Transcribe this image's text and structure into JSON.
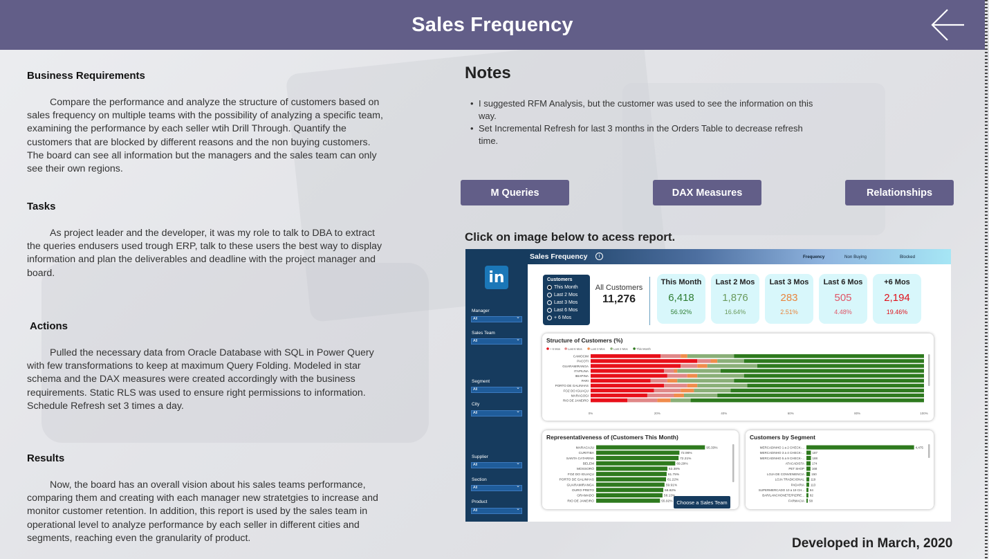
{
  "header": {
    "title": "Sales Frequency"
  },
  "left": {
    "business": {
      "heading": "Business Requirements",
      "text": "Compare the performance and analyze the structure of customers based on sales frequency on multiple teams with the possibility of analyzing a specific team, examining the performance by each seller wtih Drill Through. Quantify the customers that are blocked by different reasons and the non buying customers. The board can see all information but the managers and the sales team can only see their own regions."
    },
    "tasks": {
      "heading": "Tasks",
      "text": "As project leader and the developer, it was my role to talk to DBA to extract the queries endusers used trough ERP, talk to these users the best way to display information and plan the deliverables and deadline with the project manager and board."
    },
    "actions": {
      "heading": "Actions",
      "text": "Pulled the necessary data from Oracle Database with SQL in Power Query with few transformations to keep at maximum Query Folding. Modeled in star schema and the DAX measures were created accordingly with the business requirements. Static RLS was used to ensure right permissions to information. Schedule Refresh set 3 times a day."
    },
    "results": {
      "heading": "Results",
      "text": "Now, the board has an overall vision about his sales teams performance, comparing them and creating with each manager new stratetgies to increase and monitor customer retention. In addition, this report is used by the sales team in operational level to analyze performance by each seller in different cities and segments, reaching even the granularity of product."
    }
  },
  "notes": {
    "title": "Notes",
    "items": [
      "I suggested RFM Analysis, but the customer was used to see the information on this way.",
      "Set Incremental Refresh for last 3 months in the Orders Table to decrease refresh time."
    ]
  },
  "buttons": {
    "m_queries": "M Queries",
    "dax": "DAX Measures",
    "relationships": "Relationships"
  },
  "cta": "Click on image below to acess report.",
  "footer": "Developed in March, 2020",
  "report": {
    "title": "Sales Frequency",
    "info_icon": "i",
    "tabs": [
      "Frequency",
      "Non Buying",
      "Blocked"
    ],
    "logo": "in",
    "filters": [
      {
        "label": "Manager",
        "value": "All"
      },
      {
        "label": "Sales Team",
        "value": "All"
      },
      {
        "label": "Segment",
        "value": "All"
      },
      {
        "label": "City",
        "value": "All"
      },
      {
        "label": "Supplier",
        "value": "All"
      },
      {
        "label": "Section",
        "value": "All"
      },
      {
        "label": "Product",
        "value": "All"
      }
    ],
    "customers_selector": {
      "title": "Customers",
      "options": [
        "This Month",
        "Last 2 Mos",
        "Last 3 Mos",
        "Last 6 Mos",
        "+ 6 Mos"
      ]
    },
    "all_customers": {
      "label": "All Customers",
      "value": "11,276"
    },
    "kpis": [
      {
        "title": "This Month",
        "value": "6,418",
        "pct": "56.92%",
        "color": "#2e7d32"
      },
      {
        "title": "Last 2 Mos",
        "value": "1,876",
        "pct": "16.64%",
        "color": "#6a9a5c"
      },
      {
        "title": "Last 3 Mos",
        "value": "283",
        "pct": "2.51%",
        "color": "#e8843c"
      },
      {
        "title": "Last 6 Mos",
        "value": "505",
        "pct": "4.48%",
        "color": "#e05566"
      },
      {
        "title": "+6 Mos",
        "value": "2,194",
        "pct": "19.46%",
        "color": "#e0101a"
      }
    ],
    "chart_data": [
      {
        "type": "bar",
        "title": "Structure of Customers (%)",
        "legend": [
          "+ 6 Mos",
          "Last 6 Mos",
          "Last 3 Mos",
          "Last 2 Mos",
          "This Month"
        ],
        "colors": [
          "#e8101a",
          "#e08888",
          "#f08c4c",
          "#8aaf78",
          "#2e7a1e"
        ],
        "categories": [
          "CAMOCIM",
          "PACOTI",
          "GUARAMIRANGA",
          "ITAPIUNA",
          "IBIAPINA",
          "PARI",
          "PORTO DE GALINHAS",
          "FOZ DO IGUAÇU",
          "MARAGOGI",
          "RIO DE JANEIRO"
        ],
        "series_pct": [
          [
            21,
            6,
            2,
            14,
            57
          ],
          [
            32,
            4,
            2,
            8,
            54
          ],
          [
            27,
            5,
            3,
            15,
            50
          ],
          [
            22,
            3,
            1,
            13,
            61
          ],
          [
            23,
            6,
            3,
            14,
            54
          ],
          [
            18,
            5,
            3,
            17,
            57
          ],
          [
            22,
            7,
            3,
            15,
            53
          ],
          [
            19,
            8,
            4,
            11,
            58
          ],
          [
            17,
            8,
            3,
            10,
            62
          ],
          [
            11,
            9,
            4,
            6,
            70
          ]
        ],
        "x_ticks": [
          "0%",
          "20%",
          "40%",
          "60%",
          "80%",
          "100%"
        ]
      },
      {
        "type": "bar",
        "title": "Representativeness of (Customers This Month)",
        "categories": [
          "MARACAJU",
          "CURITIBA",
          "SANTA CATARINA",
          "BELEM",
          "MOSSORÓ",
          "FOZ DO IGUAÇU",
          "PORTO DE GALINHAS",
          "GUARAMIRANGA",
          "OURO PRETO",
          "GRAMADO",
          "RIO DE JANEIRO"
        ],
        "values": [
          95.33,
          72.96,
          72.21,
          69.29,
          62.38,
          61.75,
          61.22,
          59.91,
          58.82,
          58.13,
          55.92
        ],
        "labels": [
          "95.33%",
          "72.96%",
          "72.21%",
          "69.29%",
          "62.38%",
          "61.75%",
          "61.22%",
          "59.91%",
          "58.82%",
          "58.13%",
          "55.92%"
        ],
        "xlim": [
          0,
          100
        ]
      },
      {
        "type": "bar",
        "title": "Customers by Segment",
        "categories": [
          "MERCADINHO 1 a 2 CHECK-...",
          "MERCADINHO 3 a 4 CHECK-...",
          "MERCADINHO 5 a 9 CHECK-...",
          "ATACADISTA",
          "PET SHOP",
          "LOJA DE CONVENIENCIA",
          "LOJA TRADICIONAL",
          "PADARIA",
          "SUPERMERCADO 10 a 19 CH...",
          "BAR/LANCHONETE/PIZ/RE...",
          "FARMACIA"
        ],
        "values": [
          4475,
          187,
          188,
          174,
          168,
          150,
          119,
          113,
          84,
          82,
          58
        ],
        "labels": [
          "4,475",
          "187",
          "188",
          "174",
          "168",
          "150",
          "119",
          "113",
          "84",
          "82",
          "58"
        ],
        "xlim": [
          0,
          4600
        ]
      }
    ],
    "choose_team": "Choose a Sales Team"
  }
}
